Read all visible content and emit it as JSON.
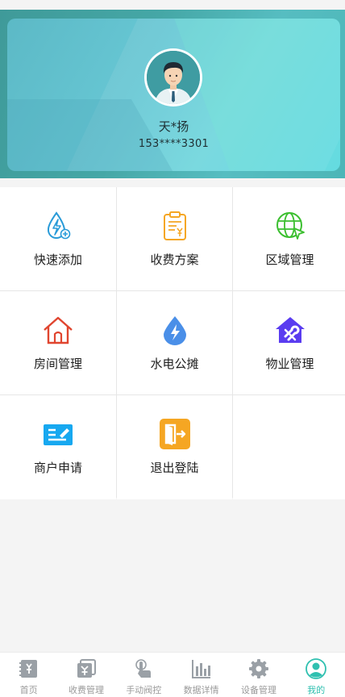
{
  "profile": {
    "name": "天*扬",
    "phone": "153****3301"
  },
  "menu": [
    {
      "label": "快速添加",
      "icon": "quick-add-icon"
    },
    {
      "label": "收费方案",
      "icon": "fee-plan-icon"
    },
    {
      "label": "区域管理",
      "icon": "region-globe-icon"
    },
    {
      "label": "房间管理",
      "icon": "house-icon"
    },
    {
      "label": "水电公摊",
      "icon": "utility-share-icon"
    },
    {
      "label": "物业管理",
      "icon": "property-tools-icon"
    },
    {
      "label": "商户申请",
      "icon": "merchant-apply-icon"
    },
    {
      "label": "退出登陆",
      "icon": "logout-icon"
    }
  ],
  "tabs": [
    {
      "label": "首页",
      "icon": "home-receipt-icon",
      "active": false
    },
    {
      "label": "收费管理",
      "icon": "fee-manage-icon",
      "active": false
    },
    {
      "label": "手动阀控",
      "icon": "hand-control-icon",
      "active": false
    },
    {
      "label": "数据详情",
      "icon": "bar-stats-icon",
      "active": false
    },
    {
      "label": "设备管理",
      "icon": "gear-icon",
      "active": false
    },
    {
      "label": "我的",
      "icon": "profile-icon",
      "active": true
    }
  ],
  "colors": {
    "accent": "#2fc0b0",
    "header": "#45a7a6",
    "blue": "#2a9bd8",
    "orange": "#f5a623",
    "green": "#3bbf2f",
    "red": "#e0452f",
    "purple": "#5a3cf0"
  }
}
